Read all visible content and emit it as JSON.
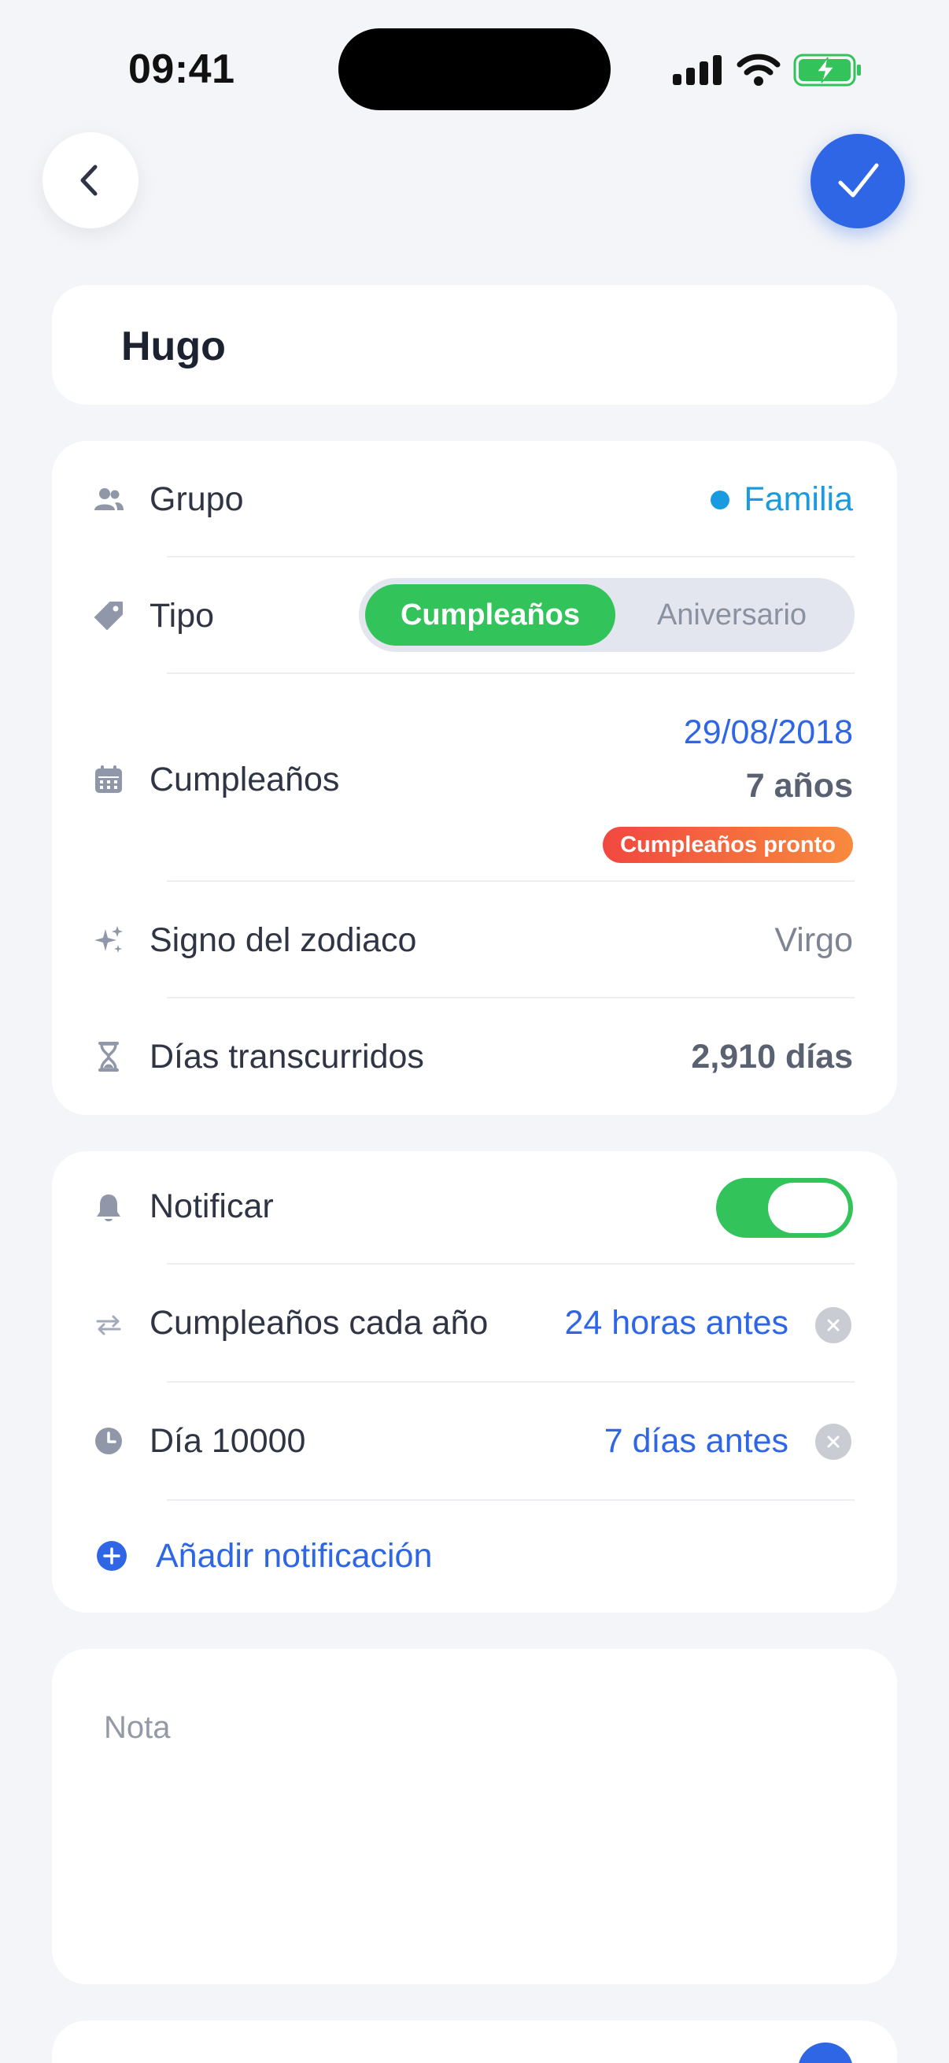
{
  "status": {
    "time": "09:41"
  },
  "person": {
    "name": "Hugo"
  },
  "info": {
    "group": {
      "label": "Grupo",
      "value": "Familia",
      "dot_color": "#1a9be0"
    },
    "type": {
      "label": "Tipo",
      "options": [
        "Cumpleaños",
        "Aniversario"
      ],
      "selected": "Cumpleaños"
    },
    "birthday": {
      "label": "Cumpleaños",
      "date": "29/08/2018",
      "age": "7 años",
      "badge": "Cumpleaños pronto"
    },
    "zodiac": {
      "label": "Signo del zodiaco",
      "value": "Virgo"
    },
    "elapsed": {
      "label": "Días transcurridos",
      "value": "2,910 días"
    }
  },
  "notifications": {
    "label": "Notificar",
    "enabled": true,
    "items": [
      {
        "label": "Cumpleaños cada año",
        "value": "24 horas antes"
      },
      {
        "label": "Día 10000",
        "value": "7 días antes"
      }
    ],
    "add_label": "Añadir notificación"
  },
  "note": {
    "placeholder": "Nota"
  },
  "colors": {
    "accent": "#2f66e6",
    "green": "#32c35b",
    "background": "#f4f5f8"
  },
  "icons": [
    "chevron-left-icon",
    "checkmark-icon",
    "people-icon",
    "tag-icon",
    "calendar-icon",
    "sparkles-icon",
    "hourglass-icon",
    "bell-icon",
    "repeat-icon",
    "clock-icon",
    "plus-circle-icon",
    "close-icon"
  ]
}
